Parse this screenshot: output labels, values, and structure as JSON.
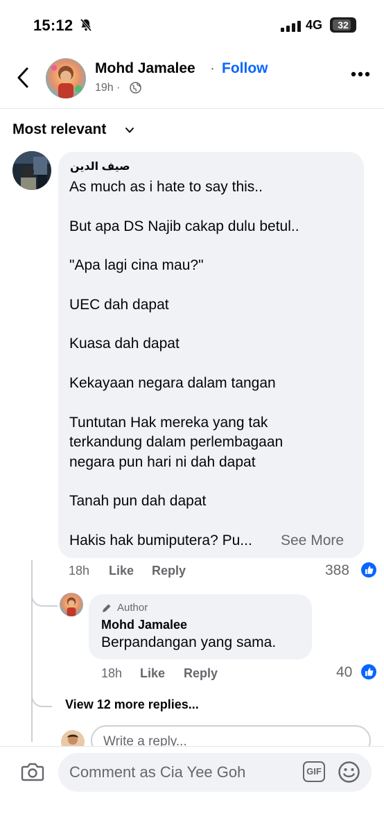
{
  "status_bar": {
    "time": "15:12",
    "network": "4G",
    "battery": "32"
  },
  "header": {
    "poster_name": "Mohd Jamalee",
    "separator": "·",
    "follow_label": "Follow",
    "time": "19h ·"
  },
  "sort": {
    "label": "Most relevant"
  },
  "comment": {
    "author": "صيف الدين",
    "lines": [
      "As much as i hate to say this..",
      "But apa DS Najib cakap dulu betul..",
      "\"Apa lagi cina mau?\"",
      "UEC dah dapat",
      "Kuasa dah dapat",
      "Kekayaan negara dalam tangan",
      "Tuntutan Hak mereka yang tak",
      "terkandung dalam perlembagaan",
      "negara pun hari ni dah dapat",
      "Tanah pun dah dapat",
      "Hakis hak bumiputera? Pu..."
    ],
    "see_more": "See More",
    "time": "18h",
    "like_label": "Like",
    "reply_label": "Reply",
    "reaction_count": "388"
  },
  "reply": {
    "badge": "Author",
    "author": "Mohd Jamalee",
    "text": "Berpandangan yang sama.",
    "time": "18h",
    "like_label": "Like",
    "reply_label": "Reply",
    "reaction_count": "40"
  },
  "view_more_replies": "View 12 more replies...",
  "reply_input": {
    "placeholder": "Write a reply..."
  },
  "composer": {
    "placeholder": "Comment as Cia Yee Goh",
    "gif_label": "GIF"
  },
  "colors": {
    "accent": "#0866ff",
    "bubble": "#f0f2f5",
    "muted": "#65676b"
  }
}
